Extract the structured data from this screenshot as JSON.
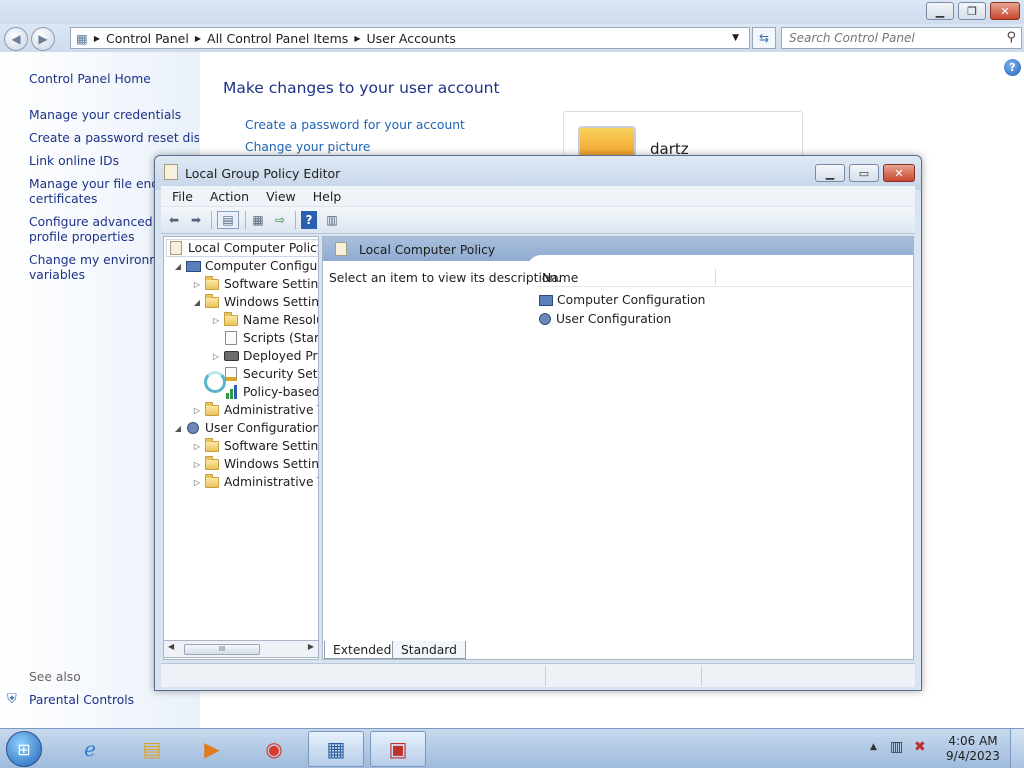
{
  "control_panel": {
    "breadcrumb": [
      "Control Panel",
      "All Control Panel Items",
      "User Accounts"
    ],
    "search_placeholder": "Search Control Panel",
    "left_links": [
      "Control Panel Home",
      "Manage your credentials",
      "Create a password reset disk",
      "Link online IDs",
      "Manage your file encryp",
      "certificates",
      "Configure advanced use",
      "profile properties",
      "Change my environmen",
      "variables"
    ],
    "see_also": "See also",
    "parental_controls": "Parental Controls",
    "main_title": "Make changes to your user account",
    "main_links": [
      "Create a password for your account",
      "Change your picture"
    ],
    "user_name": "dartz"
  },
  "gpe": {
    "title": "Local Group Policy Editor",
    "menu": [
      "File",
      "Action",
      "View",
      "Help"
    ],
    "tree": [
      {
        "label": "Local Computer Policy",
        "level": 0
      },
      {
        "label": "Computer Configura",
        "level": 1
      },
      {
        "label": "Software Settings",
        "level": 2
      },
      {
        "label": "Windows Setting",
        "level": 2
      },
      {
        "label": "Name Resolu",
        "level": 3
      },
      {
        "label": "Scripts (Startu",
        "level": 3
      },
      {
        "label": "Deployed Prir",
        "level": 3
      },
      {
        "label": "Security Settir",
        "level": 3
      },
      {
        "label": "Policy-based",
        "level": 3
      },
      {
        "label": "Administrative Te",
        "level": 2
      },
      {
        "label": "User Configuration",
        "level": 1
      },
      {
        "label": "Software Settings",
        "level": 2
      },
      {
        "label": "Windows Setting",
        "level": 2
      },
      {
        "label": "Administrative Te",
        "level": 2
      }
    ],
    "right_header": "Local Computer Policy",
    "description": "Select an item to view its description.",
    "column_name": "Name",
    "items": [
      "Computer Configuration",
      "User Configuration"
    ],
    "tabs": [
      "Extended",
      "Standard"
    ],
    "scroll_thumb": "III"
  },
  "taskbar": {
    "time": "4:06 AM",
    "date": "9/4/2023"
  }
}
